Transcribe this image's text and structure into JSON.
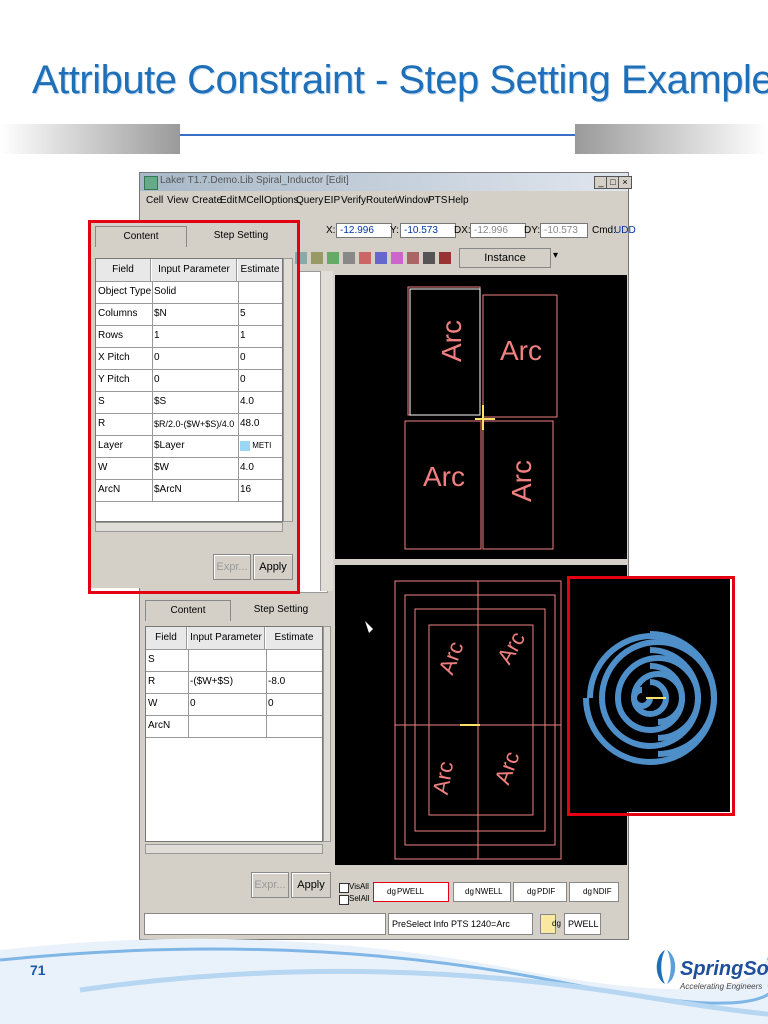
{
  "slide": {
    "title": "Attribute Constraint - Step Setting Example",
    "page_number": "71",
    "logo_text": "SpringSoft",
    "logo_tagline": "Accelerating Engineers"
  },
  "window": {
    "title": "Laker T1.7.Demo.Lib Spiral_Inductor [Edit]",
    "controls": [
      "_",
      "□",
      "×"
    ],
    "menu": [
      "Cell",
      "View",
      "Create",
      "Edit",
      "MCell",
      "Options",
      "Query",
      "EIP",
      "Verify",
      "Router",
      "Window",
      "PTS",
      "Help"
    ],
    "coords": {
      "x_label": "X:",
      "x": "-12.996",
      "y_label": "Y:",
      "y": "-10.573",
      "dx_label": "DX:",
      "dx": "-12.996",
      "dy_label": "DY:",
      "dy": "-10.573",
      "cmd_label": "Cmd:",
      "cmd": "UDD"
    },
    "instance_label": "Instance"
  },
  "panel1": {
    "tabs": [
      "Content",
      "Step Setting"
    ],
    "headers": [
      "Field",
      "Input Parameter",
      "Estimate"
    ],
    "rows": [
      [
        "Object Type",
        "Solid",
        ""
      ],
      [
        "Columns",
        "$N",
        "5"
      ],
      [
        "Rows",
        "1",
        "1"
      ],
      [
        "X Pitch",
        "0",
        "0"
      ],
      [
        "Y Pitch",
        "0",
        "0"
      ],
      [
        "S",
        "$S",
        "4.0"
      ],
      [
        "R",
        "$R/2.0-($W+$S)/4.0",
        "48.0"
      ],
      [
        "Layer",
        "$Layer",
        "METI"
      ],
      [
        "W",
        "$W",
        "4.0"
      ],
      [
        "ArcN",
        "$ArcN",
        "16"
      ]
    ],
    "buttons": [
      "Expr...",
      "Apply"
    ]
  },
  "panel2": {
    "tabs": [
      "Content",
      "Step Setting"
    ],
    "headers": [
      "Field",
      "Input Parameter",
      "Estimate"
    ],
    "rows": [
      [
        "S",
        "",
        ""
      ],
      [
        "R",
        "-($W+$S)",
        "-8.0"
      ],
      [
        "W",
        "0",
        "0"
      ],
      [
        "ArcN",
        "",
        ""
      ]
    ],
    "buttons": [
      "Expr...",
      "Apply"
    ]
  },
  "layers": {
    "vis_all": "VisAll",
    "sel_all": "SelAll",
    "items": [
      {
        "tag": "dg",
        "name": "PWELL"
      },
      {
        "tag": "dg",
        "name": "NWELL"
      },
      {
        "tag": "dg",
        "name": "PDIF"
      },
      {
        "tag": "dg",
        "name": "NDIF"
      }
    ]
  },
  "status": {
    "info": "PreSelect Info PTS 1240=Arc",
    "layer_tag": "dg",
    "layer": "PWELL"
  },
  "canvas_labels": {
    "arc": "Arc"
  },
  "colors": {
    "title_blue": "#1f6fb8",
    "highlight_red": "#e30012",
    "layout_pink": "#f07f7f",
    "spiral_blue": "#4f8fc9"
  }
}
